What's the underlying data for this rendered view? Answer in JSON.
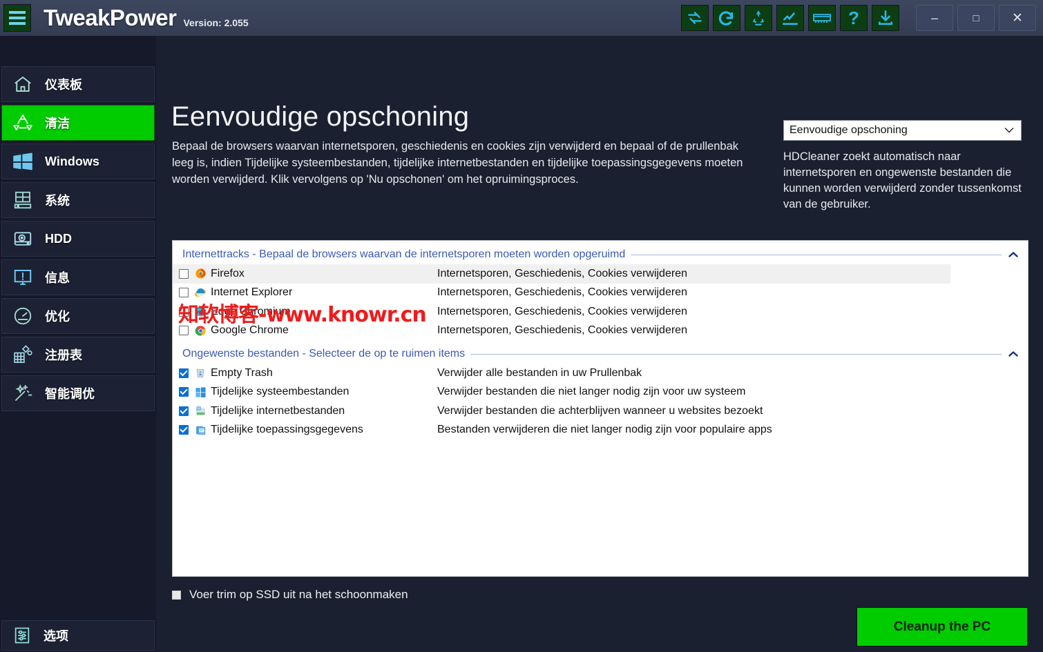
{
  "app": {
    "title": "TweakPower",
    "version_label": "Version: 2.055",
    "menu_icon": "hamburger-menu-icon"
  },
  "titlebar": {
    "icons": [
      {
        "name": "sync-icon",
        "label": "Sync"
      },
      {
        "name": "redo-icon",
        "label": "Redo"
      },
      {
        "name": "recycle-icon",
        "label": "Recycle"
      },
      {
        "name": "chart-icon",
        "label": "Chart"
      },
      {
        "name": "ram-icon",
        "label": "Memory"
      },
      {
        "name": "help-icon",
        "label": "?"
      },
      {
        "name": "download-icon",
        "label": "Download"
      }
    ],
    "window_buttons": [
      {
        "name": "minimize-button",
        "glyph": "–"
      },
      {
        "name": "maximize-button",
        "glyph": "□"
      },
      {
        "name": "close-button",
        "glyph": "✕"
      }
    ]
  },
  "sidebar": {
    "items": [
      {
        "label": "仪表板",
        "icon": "home-icon",
        "active": false
      },
      {
        "label": "清洁",
        "icon": "recycle-icon",
        "active": true
      },
      {
        "label": "Windows",
        "icon": "windows-icon",
        "active": false
      },
      {
        "label": "系统",
        "icon": "system-icon",
        "active": false
      },
      {
        "label": "HDD",
        "icon": "harddisk-icon",
        "active": false
      },
      {
        "label": "信息",
        "icon": "monitor-info-icon",
        "active": false
      },
      {
        "label": "优化",
        "icon": "gauge-icon",
        "active": false
      },
      {
        "label": "注册表",
        "icon": "registry-icon",
        "active": false
      },
      {
        "label": "智能调优",
        "icon": "magic-wand-icon",
        "active": false
      }
    ],
    "options": {
      "label": "选项",
      "icon": "sliders-icon"
    }
  },
  "main": {
    "page_title": "Eenvoudige opschoning",
    "page_desc": "Bepaal de browsers waarvan internetsporen, geschiedenis en cookies zijn verwijderd en bepaal of de prullenbak leeg is, indien Tijdelijke systeembestanden, tijdelijke internetbestanden en tijdelijke toepassingsgegevens moeten worden verwijderd. Klik vervolgens op 'Nu opschonen' om het opruimingsproces.",
    "mode_select_value": "Eenvoudige opschoning",
    "mode_desc": "HDCleaner zoekt automatisch naar internetsporen en ongewenste bestanden die kunnen worden verwijderd zonder tussenkomst van de gebruiker.",
    "watermark": "知软博客-www.knowr.cn"
  },
  "groups": [
    {
      "header": "Internettracks - Bepaal de browsers waarvan de internetsporen moeten worden opgeruimd",
      "chevron": "chevron-up-icon",
      "rows": [
        {
          "name": "Firefox",
          "desc": "Internetsporen, Geschiedenis, Cookies verwijderen",
          "checked": false,
          "icon": "firefox-icon",
          "highlighted": true
        },
        {
          "name": "Internet Explorer",
          "desc": "Internetsporen, Geschiedenis, Cookies verwijderen",
          "checked": false,
          "icon": "internet-explorer-icon",
          "highlighted": false
        },
        {
          "name": "Edge Chromium",
          "desc": "Internetsporen, Geschiedenis, Cookies verwijderen",
          "checked": false,
          "icon": "edge-icon",
          "highlighted": false
        },
        {
          "name": "Google Chrome",
          "desc": "Internetsporen, Geschiedenis, Cookies verwijderen",
          "checked": false,
          "icon": "chrome-icon",
          "highlighted": false
        }
      ]
    },
    {
      "header": "Ongewenste bestanden - Selecteer de op te ruimen items",
      "chevron": "chevron-up-icon",
      "rows": [
        {
          "name": "Empty Trash",
          "desc": "Verwijder alle bestanden in uw Prullenbak",
          "checked": true,
          "icon": "trash-icon",
          "highlighted": false
        },
        {
          "name": "Tijdelijke systeembestanden",
          "desc": "Verwijder bestanden die niet langer nodig zijn voor uw systeem",
          "checked": true,
          "icon": "windows-icon",
          "highlighted": false
        },
        {
          "name": "Tijdelijke internetbestanden",
          "desc": "Verwijder bestanden die achterblijven wanneer u websites bezoekt",
          "checked": true,
          "icon": "internet-files-icon",
          "highlighted": false
        },
        {
          "name": "Tijdelijke toepassingsgegevens",
          "desc": "Bestanden verwijderen die niet langer nodig zijn voor populaire apps",
          "checked": true,
          "icon": "app-data-icon",
          "highlighted": false
        }
      ]
    }
  ],
  "footer": {
    "trim_label": "Voer trim op SSD uit na het schoonmaken",
    "trim_checked": false,
    "cleanup_button": "Cleanup the PC"
  },
  "colors": {
    "accent_green": "#00cc00",
    "background": "#1b2030",
    "sidebar": "#15192a",
    "titlebar": "#3a4359",
    "group_header_blue": "#3b59b5",
    "watermark_red": "#ee1c1c"
  }
}
